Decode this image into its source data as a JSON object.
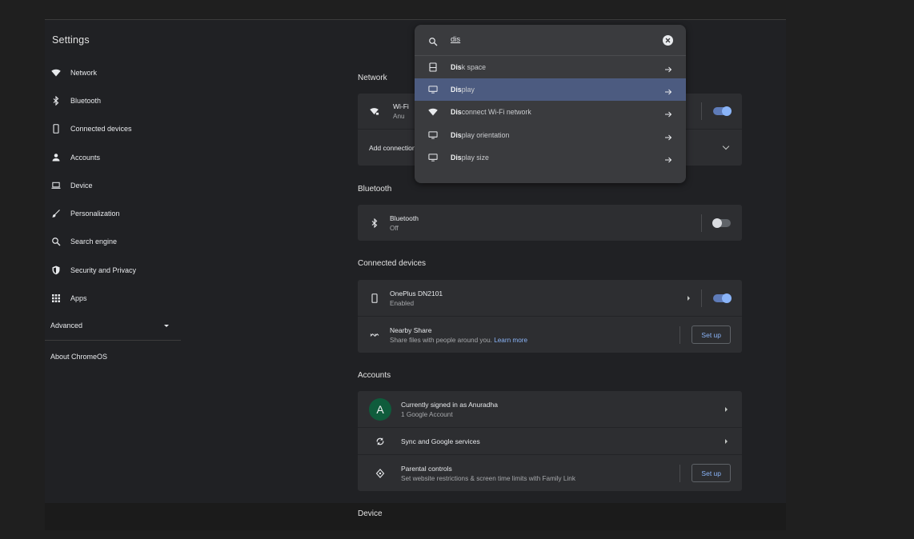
{
  "app": {
    "title": "Settings"
  },
  "sidebar": {
    "items": [
      {
        "label": "Network",
        "icon": "wifi-icon"
      },
      {
        "label": "Bluetooth",
        "icon": "bluetooth-icon"
      },
      {
        "label": "Connected devices",
        "icon": "phone-icon"
      },
      {
        "label": "Accounts",
        "icon": "person-icon"
      },
      {
        "label": "Device",
        "icon": "laptop-icon"
      },
      {
        "label": "Personalization",
        "icon": "brush-icon"
      },
      {
        "label": "Search engine",
        "icon": "search-icon"
      },
      {
        "label": "Security and Privacy",
        "icon": "shield-icon"
      },
      {
        "label": "Apps",
        "icon": "apps-grid-icon"
      }
    ],
    "advanced": "Advanced",
    "about": "About ChromeOS"
  },
  "search": {
    "query": "dis",
    "results": [
      {
        "match": "Dis",
        "rest": "k space",
        "icon": "storage-icon",
        "active": false
      },
      {
        "match": "Dis",
        "rest": "play",
        "icon": "display-icon",
        "active": true
      },
      {
        "match": "Dis",
        "rest": "connect Wi-Fi network",
        "icon": "wifi-icon",
        "active": false
      },
      {
        "match": "Dis",
        "rest": "play orientation",
        "icon": "display-icon",
        "active": false
      },
      {
        "match": "Dis",
        "rest": "play size",
        "icon": "display-icon",
        "active": false
      }
    ]
  },
  "network": {
    "title": "Network",
    "wifi_title": "Wi-Fi",
    "wifi_sub": "Anu",
    "wifi_on": true,
    "add_connection": "Add connection"
  },
  "bluetooth": {
    "title": "Bluetooth",
    "row_title": "Bluetooth",
    "row_sub": "Off",
    "on": false
  },
  "connected": {
    "title": "Connected devices",
    "phone_title": "OnePlus DN2101",
    "phone_sub": "Enabled",
    "phone_on": true,
    "nearby_title": "Nearby Share",
    "nearby_sub": "Share files with people around you.",
    "nearby_link": "Learn more",
    "setup_label": "Set up"
  },
  "accounts": {
    "title": "Accounts",
    "avatar_letter": "A",
    "signed_in": "Currently signed in as Anuradha",
    "signed_in_sub": "1 Google Account",
    "sync": "Sync and Google services",
    "parental_title": "Parental controls",
    "parental_sub": "Set website restrictions & screen time limits with Family Link",
    "setup_label": "Set up"
  },
  "device": {
    "title": "Device"
  },
  "colors": {
    "accent": "#8ab4f8",
    "active_result": "#4c5b80",
    "avatar": "#0f5c3c"
  }
}
